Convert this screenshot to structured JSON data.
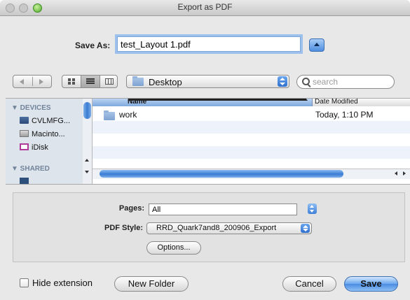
{
  "window": {
    "title": "Export as PDF"
  },
  "save_as": {
    "label": "Save As:",
    "value": "test_Layout 1.pdf"
  },
  "toolbar": {
    "location": "Desktop",
    "search_placeholder": "search"
  },
  "sidebar": {
    "devices_header": "▼ DEVICES",
    "devices": [
      "CVLMFG...",
      "Macinto...",
      "iDisk"
    ],
    "shared_header": "▼ SHARED"
  },
  "file_list": {
    "columns": [
      "Name",
      "Date Modified"
    ],
    "rows": [
      {
        "name": "work",
        "date": "Today, 1:10 PM"
      }
    ]
  },
  "options": {
    "pages_label": "Pages:",
    "pages_value": "All",
    "pdf_style_label": "PDF Style:",
    "pdf_style_value": "RRD_Quark7and8_200906_Export",
    "options_button": "Options..."
  },
  "footer": {
    "hide_extension_label": "Hide extension",
    "hide_extension_checked": false,
    "new_folder": "New Folder",
    "cancel": "Cancel",
    "save": "Save"
  },
  "colors": {
    "accent": "#3a7bd3",
    "window_bg": "#e8e8e8"
  }
}
